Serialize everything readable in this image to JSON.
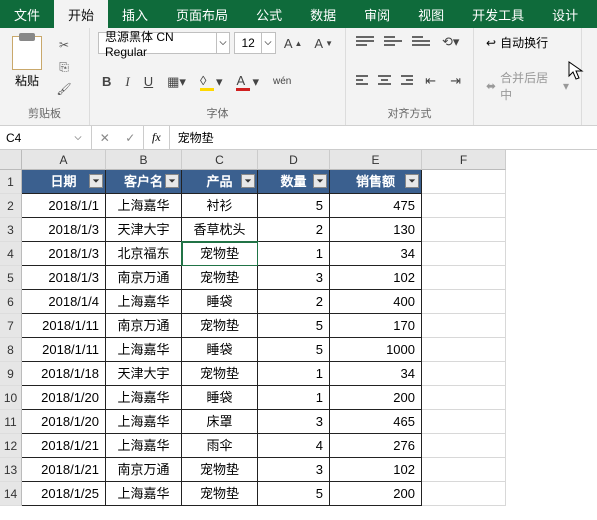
{
  "tabs": [
    "文件",
    "开始",
    "插入",
    "页面布局",
    "公式",
    "数据",
    "审阅",
    "视图",
    "开发工具",
    "设计"
  ],
  "active_tab": 1,
  "ribbon": {
    "clipboard": {
      "paste": "粘贴",
      "label": "剪贴板"
    },
    "font": {
      "name": "思源黑体 CN Regular",
      "size": "12",
      "buttons": {
        "b": "B",
        "i": "I",
        "u": "U",
        "ruby": "wén"
      },
      "label": "字体"
    },
    "align": {
      "wrap": "自动换行",
      "merge": "合并后居中",
      "label": "对齐方式"
    }
  },
  "formula_bar": {
    "name": "C4",
    "fx": "fx",
    "value": "宠物垫"
  },
  "columns": [
    "A",
    "B",
    "C",
    "D",
    "E",
    "F"
  ],
  "header_row": [
    "日期",
    "客户名",
    "产品",
    "数量",
    "销售额"
  ],
  "rows": [
    [
      "2018/1/1",
      "上海嘉华",
      "衬衫",
      "5",
      "475"
    ],
    [
      "2018/1/3",
      "天津大宇",
      "香草枕头",
      "2",
      "130"
    ],
    [
      "2018/1/3",
      "北京福东",
      "宠物垫",
      "1",
      "34"
    ],
    [
      "2018/1/3",
      "南京万通",
      "宠物垫",
      "3",
      "102"
    ],
    [
      "2018/1/4",
      "上海嘉华",
      "睡袋",
      "2",
      "400"
    ],
    [
      "2018/1/11",
      "南京万通",
      "宠物垫",
      "5",
      "170"
    ],
    [
      "2018/1/11",
      "上海嘉华",
      "睡袋",
      "5",
      "1000"
    ],
    [
      "2018/1/18",
      "天津大宇",
      "宠物垫",
      "1",
      "34"
    ],
    [
      "2018/1/20",
      "上海嘉华",
      "睡袋",
      "1",
      "200"
    ],
    [
      "2018/1/20",
      "上海嘉华",
      "床罩",
      "3",
      "465"
    ],
    [
      "2018/1/21",
      "上海嘉华",
      "雨伞",
      "4",
      "276"
    ],
    [
      "2018/1/21",
      "南京万通",
      "宠物垫",
      "3",
      "102"
    ],
    [
      "2018/1/25",
      "上海嘉华",
      "宠物垫",
      "5",
      "200"
    ]
  ],
  "active_cell": {
    "row": 3,
    "col": 2
  }
}
